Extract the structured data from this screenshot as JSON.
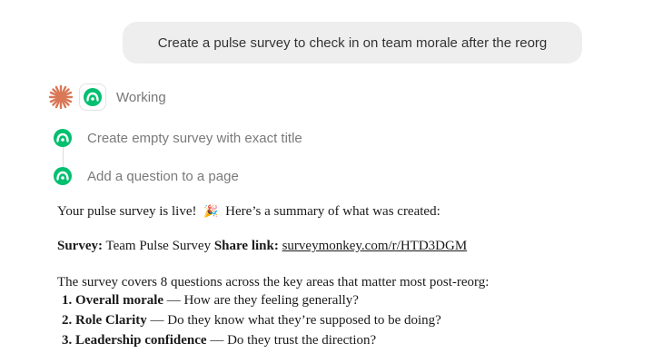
{
  "user_message": "Create a pulse survey to check in on team morale after the reorg",
  "status": {
    "label": "Working"
  },
  "steps": [
    {
      "label": "Create empty survey with exact title"
    },
    {
      "label": "Add a question to a page"
    }
  ],
  "response": {
    "intro": "Your pulse survey is live!",
    "intro_emoji": "🎉",
    "intro_after": "Here’s a summary of what was created:",
    "survey_label": "Survey:",
    "survey_name": "Team Pulse Survey",
    "share_label": "Share link:",
    "share_link": "surveymonkey.com/r/HTD3DGM",
    "coverage": "The survey covers 8 questions across the key areas that matter most post-reorg:",
    "questions": [
      {
        "num": "1.",
        "title": "Overall morale",
        "desc": " — How are they feeling generally?"
      },
      {
        "num": "2.",
        "title": " Role Clarity",
        "desc": " — Do they know what they’re supposed to be doing?"
      },
      {
        "num": "3.",
        "title": "Leadership confidence",
        "desc": " — Do they trust the direction?"
      }
    ]
  },
  "colors": {
    "brand_green": "#00bf6f",
    "spark": "#d97757",
    "bubble": "#eeeeee"
  },
  "icons": {
    "assistant": "spark-icon",
    "app": "surveymonkey-icon"
  }
}
